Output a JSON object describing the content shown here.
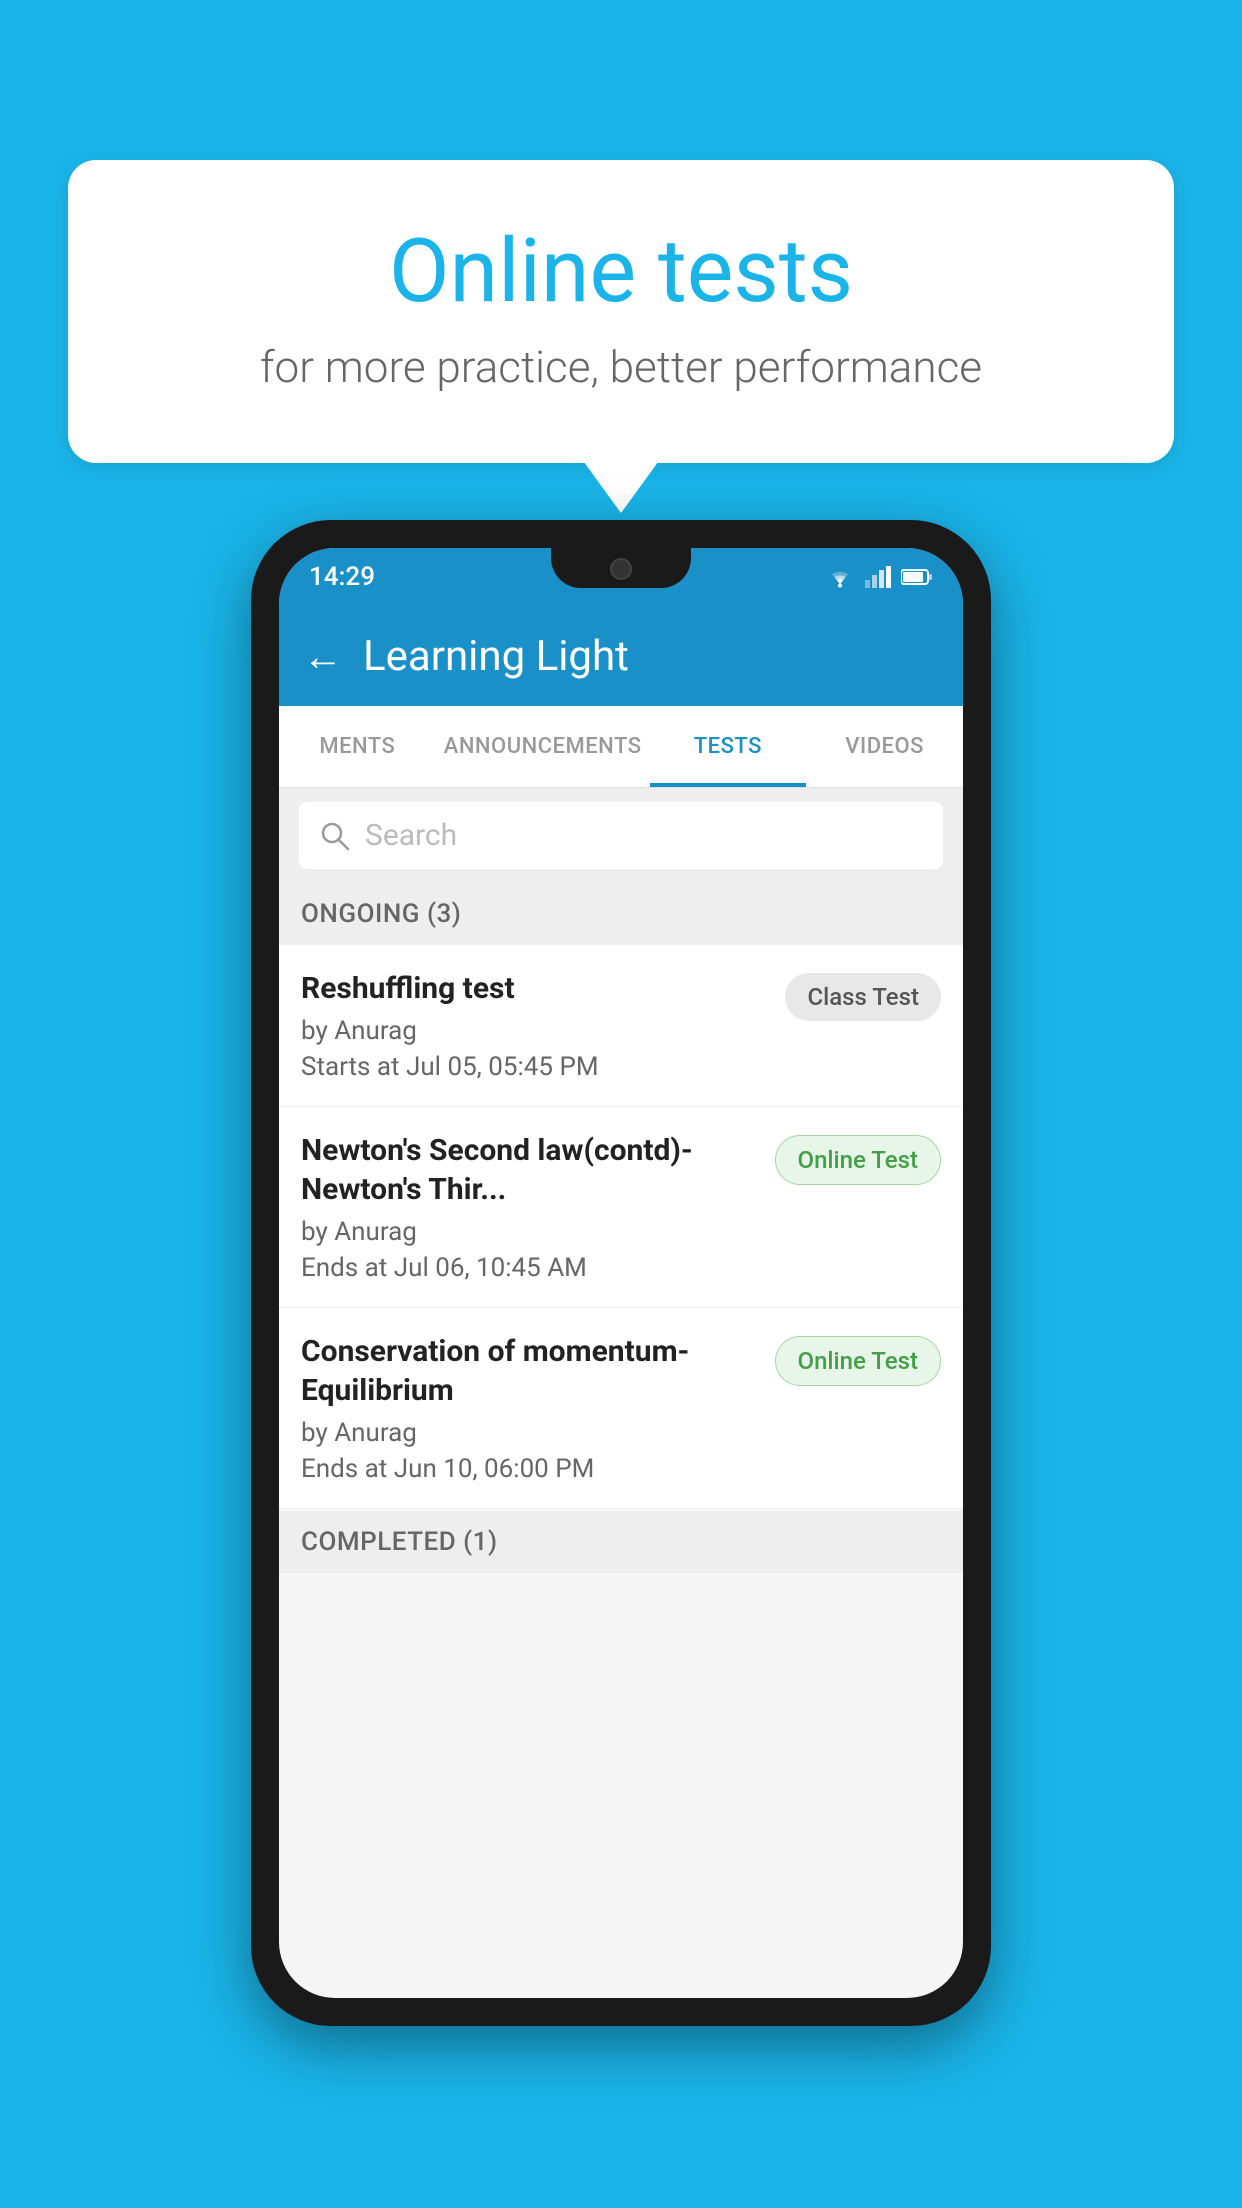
{
  "background_color": "#1ab4e8",
  "speech_bubble": {
    "title": "Online tests",
    "subtitle": "for more practice, better performance"
  },
  "phone": {
    "status_bar": {
      "time": "14:29",
      "icons": [
        "wifi",
        "signal",
        "battery"
      ]
    },
    "app_bar": {
      "title": "Learning Light",
      "back_label": "←"
    },
    "tabs": [
      {
        "label": "MENTS",
        "active": false
      },
      {
        "label": "ANNOUNCEMENTS",
        "active": false
      },
      {
        "label": "TESTS",
        "active": true
      },
      {
        "label": "VIDEOS",
        "active": false
      }
    ],
    "search": {
      "placeholder": "Search"
    },
    "ongoing_section": {
      "title": "ONGOING (3)",
      "tests": [
        {
          "name": "Reshuffling test",
          "author": "by Anurag",
          "date": "Starts at  Jul 05, 05:45 PM",
          "badge": "Class Test",
          "badge_type": "class"
        },
        {
          "name": "Newton's Second law(contd)-Newton's Thir...",
          "author": "by Anurag",
          "date": "Ends at  Jul 06, 10:45 AM",
          "badge": "Online Test",
          "badge_type": "online"
        },
        {
          "name": "Conservation of momentum-Equilibrium",
          "author": "by Anurag",
          "date": "Ends at  Jun 10, 06:00 PM",
          "badge": "Online Test",
          "badge_type": "online"
        }
      ]
    },
    "completed_section": {
      "title": "COMPLETED (1)"
    }
  }
}
